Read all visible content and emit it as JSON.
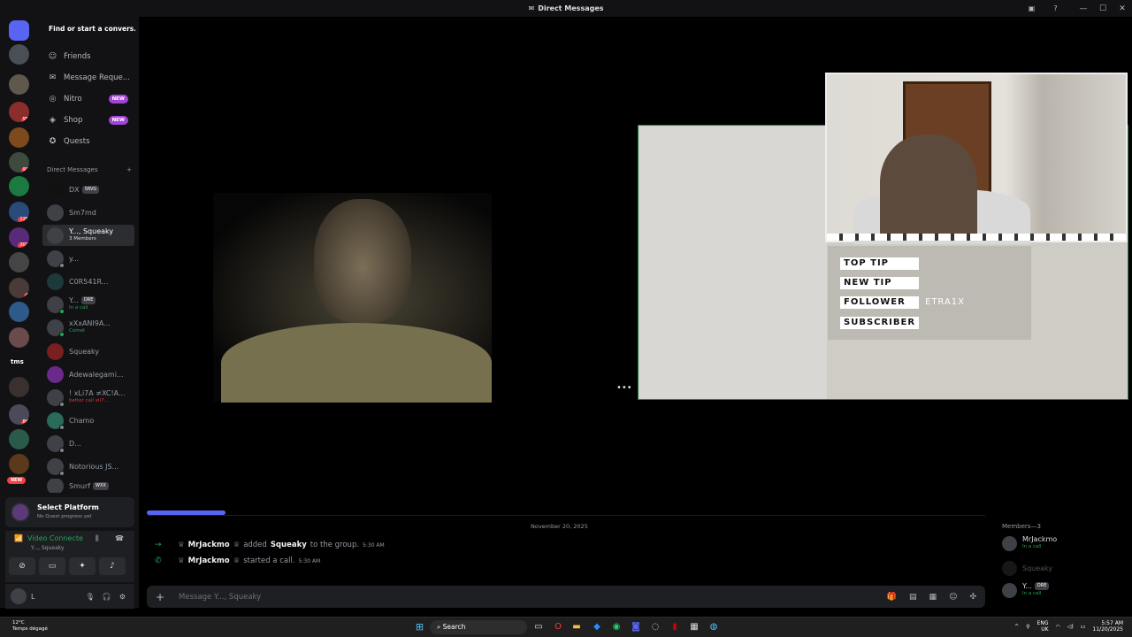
{
  "window": {
    "title": "Direct Messages"
  },
  "find_placeholder": "Find or start a convers...",
  "nav": [
    {
      "label": "Friends",
      "icon": "friends-icon"
    },
    {
      "label": "Message Reque...",
      "icon": "message-requests-icon"
    },
    {
      "label": "Nitro",
      "icon": "nitro-icon",
      "badge": "NEW"
    },
    {
      "label": "Shop",
      "icon": "shop-icon",
      "badge": "NEW"
    },
    {
      "label": "Quests",
      "icon": "quests-icon"
    }
  ],
  "dm_header": "Direct Messages",
  "dms": [
    {
      "name": "DX",
      "tag": "SRVG"
    },
    {
      "name": "Sm7md"
    },
    {
      "name": "Y..., Squeaky",
      "sub": "3 Members"
    },
    {
      "name": "y..."
    },
    {
      "name": "C0R541R..."
    },
    {
      "name": "Y...",
      "tag": "DRE",
      "sub": "In a call"
    },
    {
      "name": "xXxANI9A...",
      "sub": "Comet"
    },
    {
      "name": "Squeaky"
    },
    {
      "name": "Adewalegami..."
    },
    {
      "name": "! xLi7A ≠XC!A...",
      "sub": "better call xli7..."
    },
    {
      "name": "Chamo"
    },
    {
      "name": "D..."
    },
    {
      "name": "Notorious JS..."
    },
    {
      "name": "Smurf",
      "tag": "WXX"
    }
  ],
  "server_badges": [
    "55",
    "93",
    "128",
    "307",
    "4",
    "84",
    "NEW"
  ],
  "server_label_tms": "tms",
  "quest": {
    "title": "Select Platform",
    "sub": "No Quest progress yet"
  },
  "voice": {
    "status": "Video Connecte",
    "channel": "Y..., Squeaky"
  },
  "user": {
    "name": "L"
  },
  "alerts": [
    {
      "label": "TOP TIP",
      "value": ""
    },
    {
      "label": "NEW TIP",
      "value": ""
    },
    {
      "label": "FOLLOWER",
      "value": "ETRA1X"
    },
    {
      "label": "SUBSCRIBER",
      "value": ""
    }
  ],
  "date_divider": "November 20, 2025",
  "messages": [
    {
      "actor": "MrJackmo",
      "text": "added",
      "target": "Squeaky",
      "tail": "to the group.",
      "time": "5:30 AM"
    },
    {
      "actor": "MrJackmo",
      "text": "started a call.",
      "target": "",
      "tail": "",
      "time": "5:30 AM"
    }
  ],
  "composer": {
    "placeholder": "Message Y..., Squeaky"
  },
  "members": {
    "header": "Members—3",
    "list": [
      {
        "name": "MrJackmo",
        "sub": "In a call"
      },
      {
        "name": "Squeaky",
        "sub": ""
      },
      {
        "name": "Y...",
        "tag": "DRE",
        "sub": "In a call"
      }
    ]
  },
  "taskbar": {
    "weather_temp": "12°C",
    "weather_desc": "Temps dégagé",
    "search": "Search",
    "lang1": "ENG",
    "lang2": "UK",
    "time": "5:57 AM",
    "date": "11/20/2025"
  },
  "colors": {
    "accent": "#5865f2",
    "online": "#23a55a",
    "danger": "#f23f43",
    "bg": "#000000"
  }
}
